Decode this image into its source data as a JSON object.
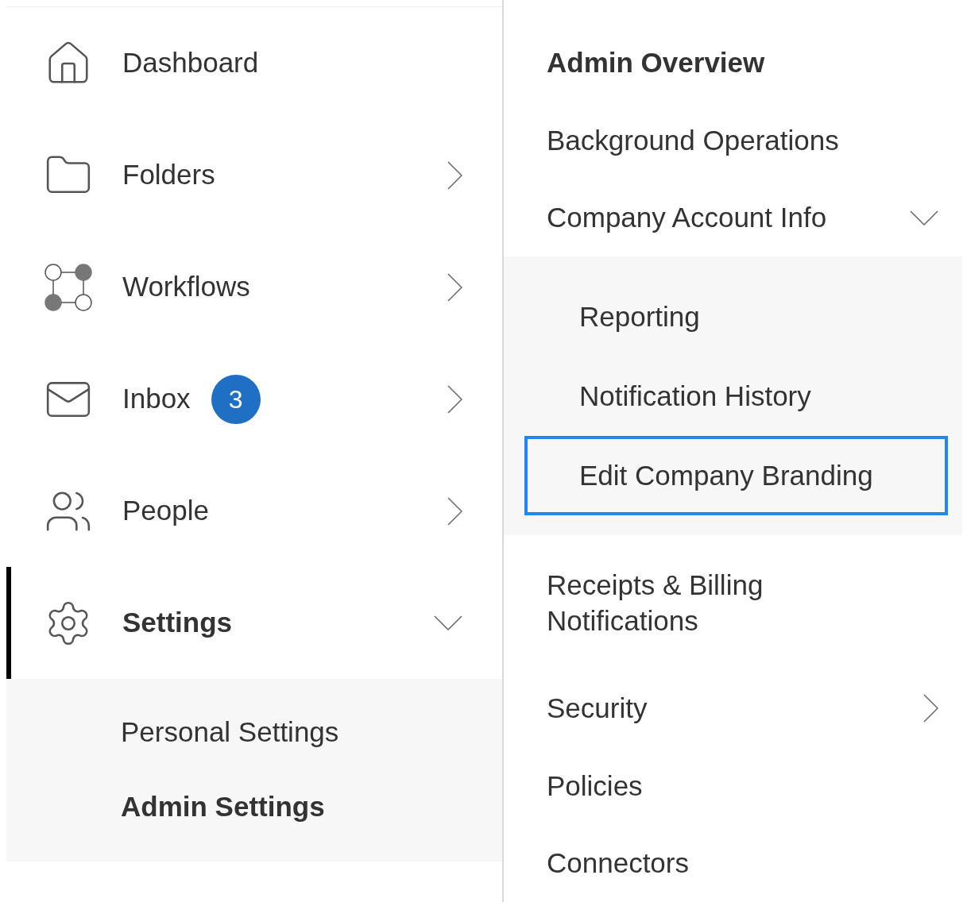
{
  "nav": {
    "items": [
      {
        "kind": "home",
        "label": "Dashboard",
        "selected": false
      },
      {
        "kind": "folder",
        "label": "Folders",
        "selected": false,
        "expanded": false
      },
      {
        "kind": "workflow",
        "label": "Workflows",
        "selected": false,
        "expanded": false
      },
      {
        "kind": "mail",
        "label": "Inbox",
        "badge": "3",
        "selected": false,
        "expanded": false
      },
      {
        "kind": "people",
        "label": "People",
        "selected": false,
        "expanded": false
      },
      {
        "kind": "gear",
        "label": "Settings",
        "selected": true,
        "expanded": true,
        "children": [
          {
            "label": "Personal Settings",
            "selected": false
          },
          {
            "label": "Admin Settings",
            "selected": true
          }
        ]
      }
    ]
  },
  "admin_menu": {
    "items": [
      {
        "label": "Admin Overview",
        "selected": true
      },
      {
        "label": "Background Operations",
        "selected": false
      },
      {
        "label": "Company Account Info",
        "selected": false,
        "expanded": true,
        "children": [
          {
            "label": "Reporting",
            "focused": false
          },
          {
            "label": "Notification History",
            "focused": false
          },
          {
            "label": "Edit Company Branding",
            "focused": true
          }
        ]
      },
      {
        "label": "Receipts & Billing Notifications",
        "selected": false
      },
      {
        "label": "Security",
        "selected": false,
        "expanded": false
      },
      {
        "label": "Policies",
        "selected": false
      },
      {
        "label": "Connectors",
        "selected": false
      }
    ]
  }
}
